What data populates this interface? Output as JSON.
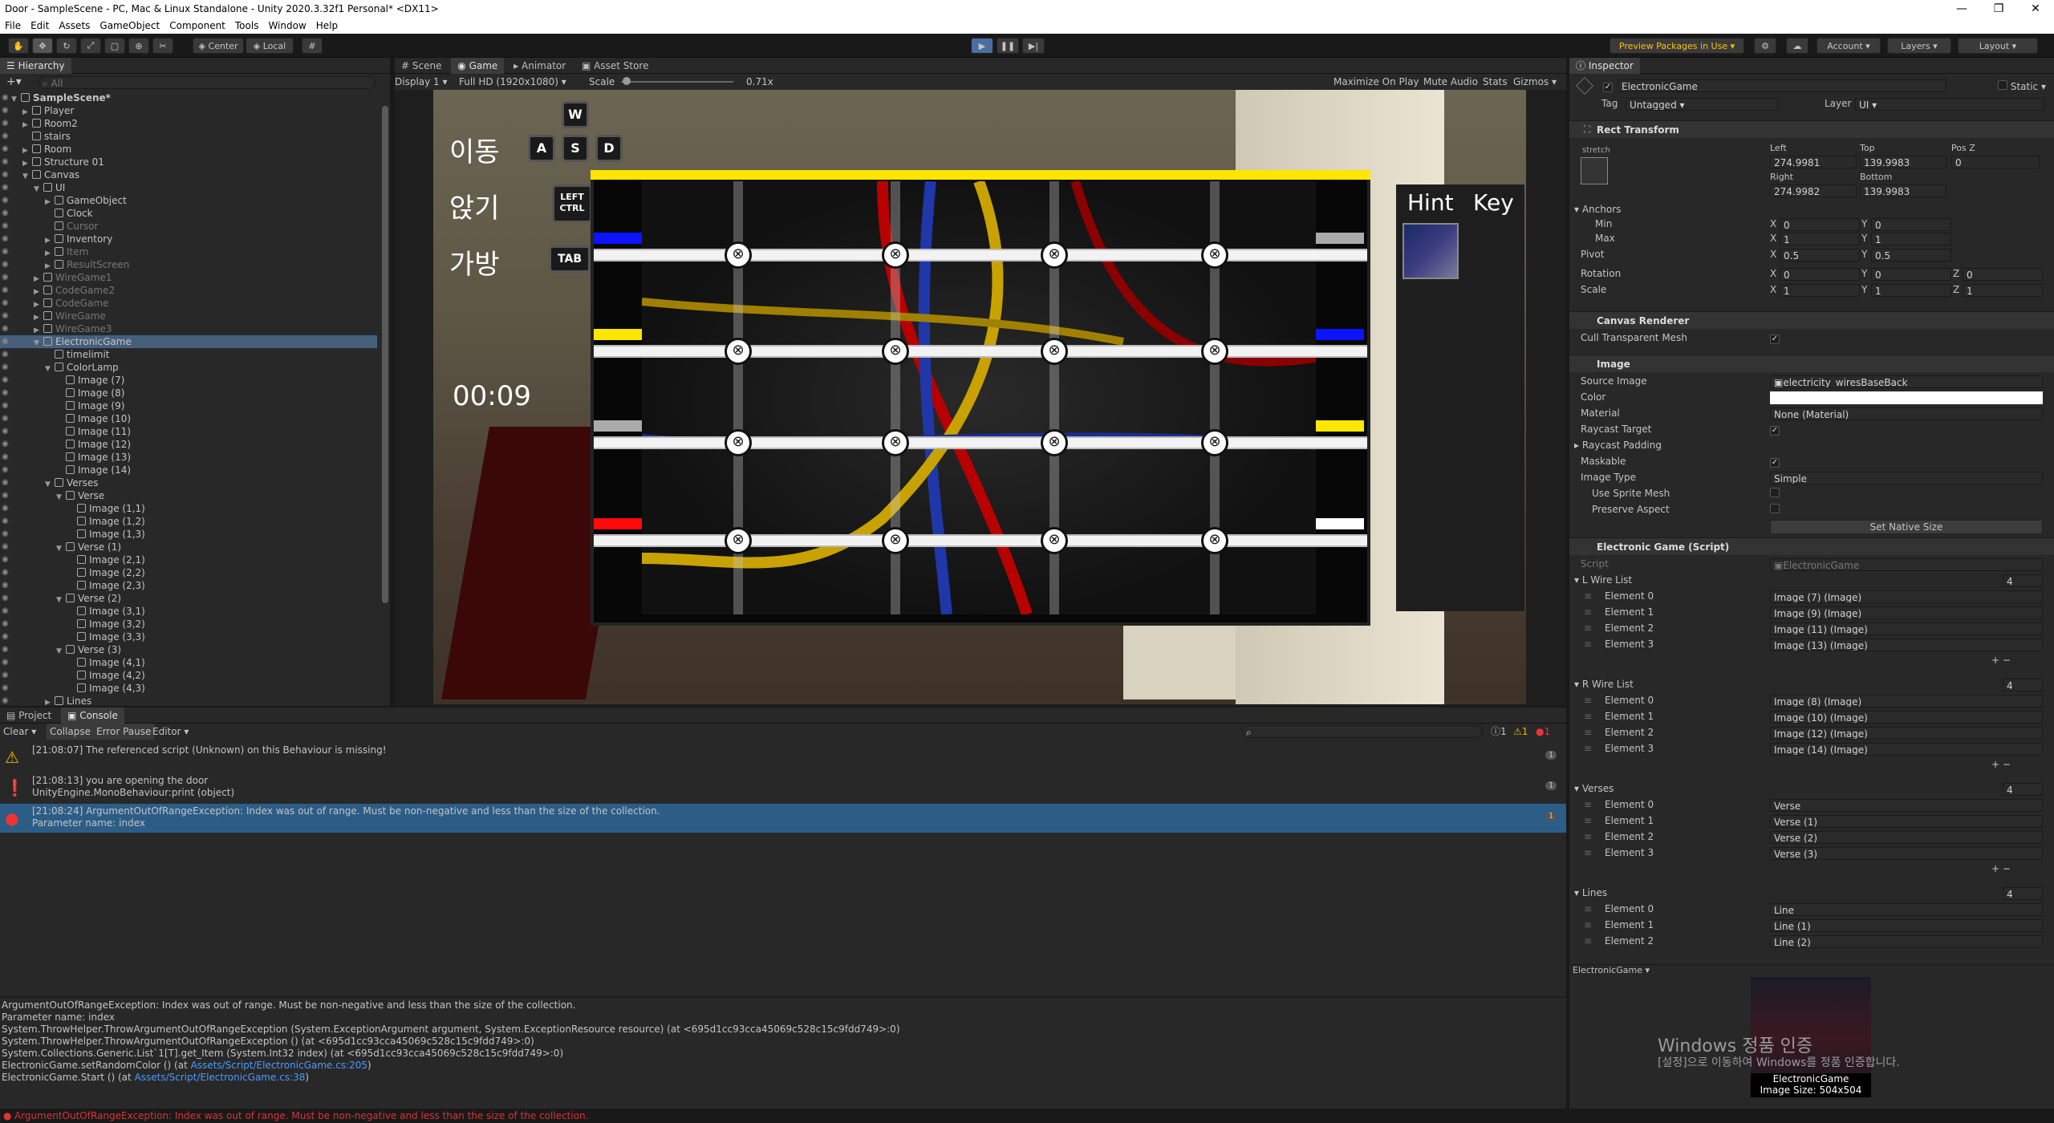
{
  "window": {
    "title": "Door - SampleScene - PC, Mac & Linux Standalone - Unity 2020.3.32f1 Personal* <DX11>",
    "controls": [
      "—",
      "❐",
      "✕"
    ]
  },
  "menu": [
    "File",
    "Edit",
    "Assets",
    "GameObject",
    "Component",
    "Tools",
    "Window",
    "Help"
  ],
  "toolbar": {
    "center": "Center",
    "local": "Local",
    "preview_packages": "Preview Packages in Use",
    "account": "Account",
    "layers": "Layers",
    "layout": "Layout"
  },
  "hierarchy": {
    "tab": "Hierarchy",
    "search_placeholder": "All",
    "items": [
      {
        "label": "SampleScene*",
        "depth": 0,
        "arrow": "▼",
        "scene": true
      },
      {
        "label": "Player",
        "depth": 1,
        "arrow": "▶"
      },
      {
        "label": "Room2",
        "depth": 1,
        "arrow": "▶"
      },
      {
        "label": "stairs",
        "depth": 1,
        "arrow": ""
      },
      {
        "label": "Room",
        "depth": 1,
        "arrow": "▶"
      },
      {
        "label": "Structure 01",
        "depth": 1,
        "arrow": "▶"
      },
      {
        "label": "Canvas",
        "depth": 1,
        "arrow": "▼"
      },
      {
        "label": "UI",
        "depth": 2,
        "arrow": "▼"
      },
      {
        "label": "GameObject",
        "depth": 3,
        "arrow": "▶"
      },
      {
        "label": "Clock",
        "depth": 3,
        "arrow": ""
      },
      {
        "label": "Cursor",
        "depth": 3,
        "arrow": "",
        "dim": true
      },
      {
        "label": "Inventory",
        "depth": 3,
        "arrow": "▶"
      },
      {
        "label": "Item",
        "depth": 3,
        "arrow": "▶",
        "dim": true
      },
      {
        "label": "ResultScreen",
        "depth": 3,
        "arrow": "▶",
        "dim": true
      },
      {
        "label": "WireGame1",
        "depth": 2,
        "arrow": "▶",
        "dim": true
      },
      {
        "label": "CodeGame2",
        "depth": 2,
        "arrow": "▶",
        "dim": true
      },
      {
        "label": "CodeGame",
        "depth": 2,
        "arrow": "▶",
        "dim": true
      },
      {
        "label": "WireGame",
        "depth": 2,
        "arrow": "▶",
        "dim": true
      },
      {
        "label": "WireGame3",
        "depth": 2,
        "arrow": "▶",
        "dim": true
      },
      {
        "label": "ElectronicGame",
        "depth": 2,
        "arrow": "▼",
        "sel": true
      },
      {
        "label": "timelimit",
        "depth": 3,
        "arrow": ""
      },
      {
        "label": "ColorLamp",
        "depth": 3,
        "arrow": "▼"
      },
      {
        "label": "Image (7)",
        "depth": 4,
        "arrow": ""
      },
      {
        "label": "Image (8)",
        "depth": 4,
        "arrow": ""
      },
      {
        "label": "Image (9)",
        "depth": 4,
        "arrow": ""
      },
      {
        "label": "Image (10)",
        "depth": 4,
        "arrow": ""
      },
      {
        "label": "Image (11)",
        "depth": 4,
        "arrow": ""
      },
      {
        "label": "Image (12)",
        "depth": 4,
        "arrow": ""
      },
      {
        "label": "Image (13)",
        "depth": 4,
        "arrow": ""
      },
      {
        "label": "Image (14)",
        "depth": 4,
        "arrow": ""
      },
      {
        "label": "Verses",
        "depth": 3,
        "arrow": "▼"
      },
      {
        "label": "Verse",
        "depth": 4,
        "arrow": "▼"
      },
      {
        "label": "Image (1,1)",
        "depth": 5,
        "arrow": ""
      },
      {
        "label": "Image (1,2)",
        "depth": 5,
        "arrow": ""
      },
      {
        "label": "Image (1,3)",
        "depth": 5,
        "arrow": ""
      },
      {
        "label": "Verse (1)",
        "depth": 4,
        "arrow": "▼"
      },
      {
        "label": "Image (2,1)",
        "depth": 5,
        "arrow": ""
      },
      {
        "label": "Image (2,2)",
        "depth": 5,
        "arrow": ""
      },
      {
        "label": "Image (2,3)",
        "depth": 5,
        "arrow": ""
      },
      {
        "label": "Verse (2)",
        "depth": 4,
        "arrow": "▼"
      },
      {
        "label": "Image (3,1)",
        "depth": 5,
        "arrow": ""
      },
      {
        "label": "Image (3,2)",
        "depth": 5,
        "arrow": ""
      },
      {
        "label": "Image (3,3)",
        "depth": 5,
        "arrow": ""
      },
      {
        "label": "Verse (3)",
        "depth": 4,
        "arrow": "▼"
      },
      {
        "label": "Image (4,1)",
        "depth": 5,
        "arrow": ""
      },
      {
        "label": "Image (4,2)",
        "depth": 5,
        "arrow": ""
      },
      {
        "label": "Image (4,3)",
        "depth": 5,
        "arrow": ""
      },
      {
        "label": "Lines",
        "depth": 3,
        "arrow": "▶"
      }
    ]
  },
  "view_tabs": [
    "Scene",
    "Game",
    "Animator",
    "Asset Store"
  ],
  "game_bar": {
    "display": "Display 1",
    "resolution": "Full HD (1920x1080)",
    "scale_label": "Scale",
    "scale_value": "0.71x",
    "maximize": "Maximize On Play",
    "mute": "Mute Audio",
    "stats": "Stats",
    "gizmos": "Gizmos"
  },
  "game_ui": {
    "move": "이동",
    "sit": "앉기",
    "bag": "가방",
    "key_w": "W",
    "key_a": "A",
    "key_s": "S",
    "key_d": "D",
    "key_ctrl": "LEFT CTRL",
    "key_tab": "TAB",
    "timer": "00:09",
    "hint": "Hint",
    "key_label": "Key",
    "left_lamps": [
      "#0a14ff",
      "#ffe600",
      "#aaaaaa",
      "#ff0a0a"
    ],
    "right_lamps": [
      "#aaaaaa",
      "#0a14ff",
      "#ffe600",
      "#ffffff"
    ]
  },
  "console": {
    "tabs": [
      "Project",
      "Console"
    ],
    "buttons": [
      "Clear",
      "Collapse",
      "Error Pause",
      "Editor"
    ],
    "counts": [
      "1",
      "1",
      "1"
    ],
    "entries": [
      {
        "type": "warn",
        "line1": "[21:08:07] The referenced script (Unknown) on this Behaviour is missing!",
        "line2": "",
        "count": "1"
      },
      {
        "type": "info",
        "line1": "[21:08:13] you are opening the door",
        "line2": "UnityEngine.MonoBehaviour:print (object)",
        "count": "1"
      },
      {
        "type": "error",
        "line1": "[21:08:24] ArgumentOutOfRangeException: Index was out of range. Must be non-negative and less than the size of the collection.",
        "line2": "Parameter name: index",
        "count": "1"
      }
    ],
    "detail": [
      "ArgumentOutOfRangeException: Index was out of range. Must be non-negative and less than the size of the collection.",
      "Parameter name: index",
      "System.ThrowHelper.ThrowArgumentOutOfRangeException (System.ExceptionArgument argument, System.ExceptionResource resource) (at <695d1cc93cca45069c528c15c9fdd749>:0)",
      "System.ThrowHelper.ThrowArgumentOutOfRangeException () (at <695d1cc93cca45069c528c15c9fdd749>:0)",
      "System.Collections.Generic.List`1[T].get_Item (System.Int32 index) (at <695d1cc93cca45069c528c15c9fdd749>:0)",
      "ElectronicGame.setRandomColor () (at Assets/Script/ElectronicGame.cs:205)",
      "ElectronicGame.Start () (at Assets/Script/ElectronicGame.cs:38)"
    ],
    "links": [
      "Assets/Script/ElectronicGame.cs:205",
      "Assets/Script/ElectronicGame.cs:38"
    ]
  },
  "status": "ArgumentOutOfRangeException: Index was out of range. Must be non-negative and less than the size of the collection.",
  "inspector": {
    "tab": "Inspector",
    "object_name": "ElectronicGame",
    "static": "Static",
    "tag_label": "Tag",
    "tag": "Untagged",
    "layer_label": "Layer",
    "layer": "UI",
    "rect": {
      "title": "Rect Transform",
      "stretch": "stretch",
      "left_l": "Left",
      "top_l": "Top",
      "posz_l": "Pos Z",
      "left": "274.9981",
      "top": "139.9983",
      "posz": "0",
      "right_l": "Right",
      "bottom_l": "Bottom",
      "right": "274.9982",
      "bottom": "139.9983",
      "anchors": "Anchors",
      "min": "Min",
      "max": "Max",
      "pivot": "Pivot",
      "rotation": "Rotation",
      "scale": "Scale",
      "min_x": "0",
      "min_y": "0",
      "max_x": "1",
      "max_y": "1",
      "pivot_x": "0.5",
      "pivot_y": "0.5",
      "rot_x": "0",
      "rot_y": "0",
      "rot_z": "0",
      "sc_x": "1",
      "sc_y": "1",
      "sc_z": "1"
    },
    "canvas_renderer": {
      "title": "Canvas Renderer",
      "cull": "Cull Transparent Mesh"
    },
    "image": {
      "title": "Image",
      "source_l": "Source Image",
      "source": "electricity_wiresBaseBack",
      "color_l": "Color",
      "material_l": "Material",
      "material": "None (Material)",
      "raycast": "Raycast Target",
      "padding": "Raycast Padding",
      "maskable": "Maskable",
      "type_l": "Image Type",
      "type": "Simple",
      "sprite_mesh": "Use Sprite Mesh",
      "aspect": "Preserve Aspect",
      "native": "Set Native Size"
    },
    "script": {
      "title": "Electronic Game (Script)",
      "script_l": "Script",
      "script": "ElectronicGame",
      "lists": [
        {
          "name": "L Wire List",
          "count": "4",
          "items": [
            [
              "Element 0",
              "Image (7) (Image)"
            ],
            [
              "Element 1",
              "Image (9) (Image)"
            ],
            [
              "Element 2",
              "Image (11) (Image)"
            ],
            [
              "Element 3",
              "Image (13) (Image)"
            ]
          ]
        },
        {
          "name": "R Wire List",
          "count": "4",
          "items": [
            [
              "Element 0",
              "Image (8) (Image)"
            ],
            [
              "Element 1",
              "Image (10) (Image)"
            ],
            [
              "Element 2",
              "Image (12) (Image)"
            ],
            [
              "Element 3",
              "Image (14) (Image)"
            ]
          ]
        },
        {
          "name": "Verses",
          "count": "4",
          "items": [
            [
              "Element 0",
              "Verse"
            ],
            [
              "Element 1",
              "Verse (1)"
            ],
            [
              "Element 2",
              "Verse (2)"
            ],
            [
              "Element 3",
              "Verse (3)"
            ]
          ]
        },
        {
          "name": "Lines",
          "count": "4",
          "items": [
            [
              "Element 0",
              "Line"
            ],
            [
              "Element 1",
              "Line (1)"
            ],
            [
              "Element 2",
              "Line (2)"
            ]
          ]
        }
      ]
    },
    "preview_label": "ElectronicGame",
    "preview_name": "ElectronicGame",
    "preview_size": "Image Size: 504x504",
    "watermark1": "Windows 정품 인증",
    "watermark2": "[설정]으로 이동하여 Windows를 정품 인증합니다."
  }
}
